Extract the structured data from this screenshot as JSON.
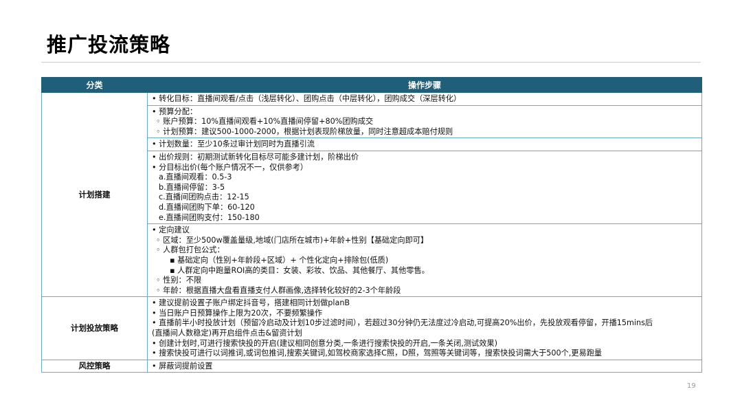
{
  "page": {
    "title": "推广投流策略",
    "page_number": "19"
  },
  "table": {
    "headers": [
      "分类",
      "操作步骤"
    ],
    "sections": [
      {
        "category": "计划搭建",
        "blocks": [
          [
            {
              "text": "• 转化目标：直播间观看/点击（浅层转化）、团购点击（中层转化），团购成交（深层转化）",
              "indent": 0
            }
          ],
          [
            {
              "text": "• 预算分配：",
              "indent": 0
            },
            {
              "text": "◦ 账户预算：10%直播间观看+10%直播间停留+80%团购成交",
              "indent": 1
            },
            {
              "text": "◦ 计划预算：建议500-1000-2000，根据计划表现阶梯放量，同时注意超成本赔付规则",
              "indent": 1
            }
          ],
          [
            {
              "text": "• 计划数量：至少10条过审计划同时为直播引流",
              "indent": 0
            }
          ],
          [
            {
              "text": "• 出价规则：初期测试新转化目标尽可能多建计划，阶梯出价",
              "indent": 0
            },
            {
              "text": "• 分目标出价(每个账户情况不一，仅供参考）",
              "indent": 0
            },
            {
              "text": "a.直播间观看：0.5-3",
              "indent": 2
            },
            {
              "text": "b.直播间停留：3-5",
              "indent": 2
            },
            {
              "text": "c.直播间团购点击：12-15",
              "indent": 2
            },
            {
              "text": "d.直播间团购下单：60-120",
              "indent": 2
            },
            {
              "text": "e.直播间团购支付：150-180",
              "indent": 2
            }
          ],
          [
            {
              "text": "• 定向建议",
              "indent": 0
            },
            {
              "text": "◦ 区域：至少500w覆盖量级,地域(门店所在城市)+年龄+性别【基础定向即可】",
              "indent": 1
            },
            {
              "text": "◦ 人群包打包公式：",
              "indent": 1
            },
            {
              "text": "▪ 基础定向（性别+年龄段+区域）+ 个性化定向+排除包(低质)",
              "indent": 3
            },
            {
              "text": "▪ 人群定向中跑量ROI高的类目：女装、彩妆、饮品、其他餐厅、其他零售。",
              "indent": 3
            },
            {
              "text": "◦ 性别：不限",
              "indent": 1
            },
            {
              "text": "◦ 年龄：根据直播大盘看直播支付人群画像,选择转化较好的2-3个年龄段",
              "indent": 1
            }
          ]
        ]
      },
      {
        "category": "计划投放策略",
        "blocks": [
          [
            {
              "text": "• 建议提前设置子账户绑定抖音号，搭建相同计划做planB",
              "indent": 0
            },
            {
              "text": "• 当日账户日预算操作上限为20次，不要频繁操作",
              "indent": 0
            },
            {
              "text": "• 直播前半小时投放计划（预留冷启动及计划10步过滤时间），若超过30分钟仍无法度过冷启动,可提高20%出价，先投放观看停留，开播15mins后",
              "indent": 0
            },
            {
              "text": "(直播间人数稳定)再开启组件点击&留资计划",
              "indent": 0
            },
            {
              "text": "• 创建计划时,可进行搜索快投的开启(建议相同创意分类,一条进行搜索快投的开启,一条关闭,测试效果)",
              "indent": 0
            },
            {
              "text": "• 搜索快投可进行以词推词,或词包推词,搜索关键词,如驾校商家选择C照，D照，驾照等关键词等，搜索快投词需大于500个,更易跑量",
              "indent": 0
            }
          ]
        ]
      },
      {
        "category": "风控策略",
        "blocks": [
          [
            {
              "text": "• 屏蔽词提前设置",
              "indent": 0
            }
          ]
        ]
      }
    ]
  }
}
